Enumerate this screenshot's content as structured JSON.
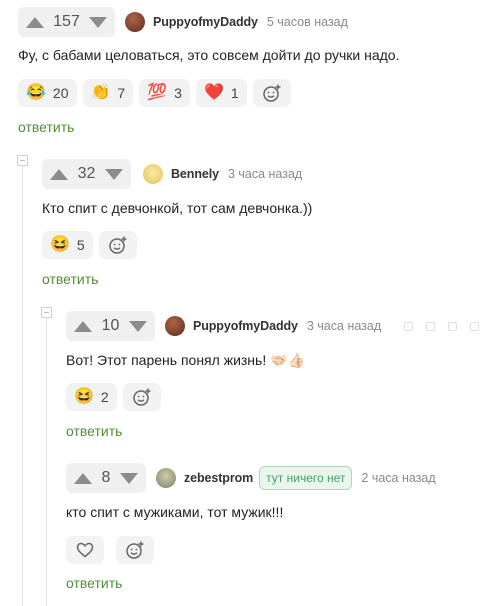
{
  "comments": [
    {
      "votes": "157",
      "username": "PuppyofmyDaddy",
      "time": "5 часов назад",
      "text": "Фу, с бабами целоваться, это совсем дойти до ручки надо.",
      "reactions": [
        {
          "icon": "laughing-face-icon",
          "glyph": "😂",
          "count": "20"
        },
        {
          "icon": "clapping-hands-icon",
          "glyph": "👏",
          "count": "7"
        },
        {
          "icon": "hundred-points-icon",
          "glyph": "💯",
          "count": "3"
        },
        {
          "icon": "red-heart-icon",
          "glyph": "❤️",
          "count": "1"
        }
      ],
      "reply": "ответить"
    },
    {
      "votes": "32",
      "username": "Bennely",
      "time": "3 часа назад",
      "text": "Кто спит с девчонкой, тот сам девчонка.))",
      "reactions": [
        {
          "icon": "grinning-face-icon",
          "glyph": "😆",
          "count": "5"
        }
      ],
      "reply": "ответить"
    },
    {
      "votes": "10",
      "username": "PuppyofmyDaddy",
      "time": "3 часа назад",
      "text": "Вот! Этот парень понял жизнь! 🤝🏻👍🏻",
      "reactions": [
        {
          "icon": "grinning-face-icon",
          "glyph": "😆",
          "count": "2"
        }
      ],
      "reply": "ответить"
    },
    {
      "votes": "8",
      "username": "zebestprom",
      "badge": "тут ничего нет",
      "time": "2 часа назад",
      "text": "кто спит с мужиками, тот мужик!!!",
      "reply": "ответить"
    }
  ],
  "colors": {
    "reply_link": "#4c8e3c",
    "vote_bg": "#f0f0f0",
    "badge_text": "#4a9a6a",
    "badge_bg": "#e9f6ee"
  }
}
